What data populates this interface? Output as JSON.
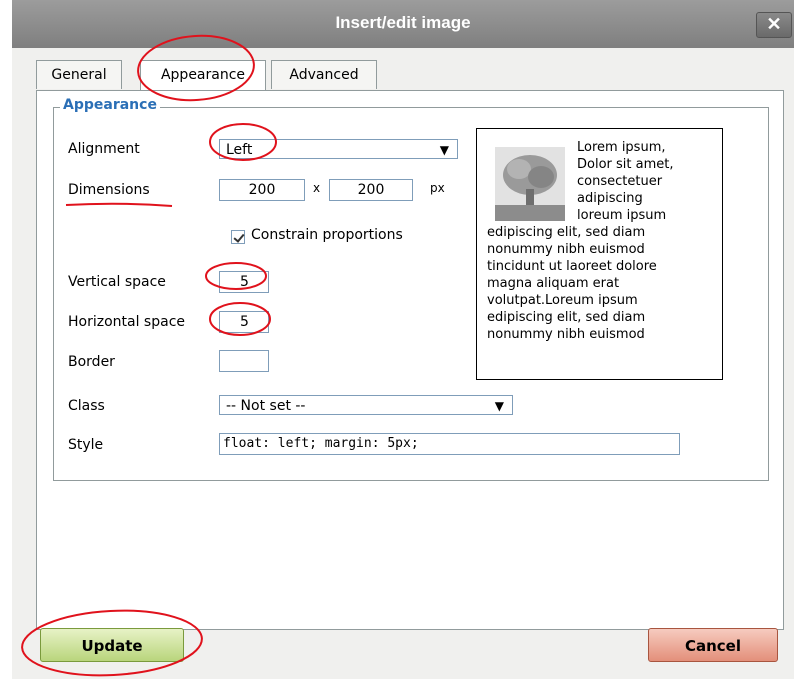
{
  "dialog": {
    "title": "Insert/edit image",
    "close_symbol": "✕"
  },
  "tabs": [
    {
      "label": "General"
    },
    {
      "label": "Appearance"
    },
    {
      "label": "Advanced"
    }
  ],
  "appearance": {
    "legend": "Appearance",
    "alignment": {
      "label": "Alignment",
      "value": "Left"
    },
    "dimensions": {
      "label": "Dimensions",
      "width": "200",
      "separator": "x",
      "height": "200",
      "unit": "px"
    },
    "constrain": {
      "label": "Constrain proportions",
      "checked": true
    },
    "vertical_space": {
      "label": "Vertical space",
      "value": "5"
    },
    "horizontal_space": {
      "label": "Horizontal space",
      "value": "5"
    },
    "border": {
      "label": "Border",
      "value": ""
    },
    "class": {
      "label": "Class",
      "value": "-- Not set --"
    },
    "style": {
      "label": "Style",
      "value": "float: left; margin: 5px;"
    }
  },
  "preview": {
    "lines_beside": [
      "Lorem ipsum,",
      "Dolor sit amet,",
      "consectetuer",
      "adipiscing",
      "loreum ipsum"
    ],
    "lines_below": [
      "edipiscing elit, sed diam",
      "nonummy nibh euismod",
      "tincidunt ut laoreet dolore",
      "magna aliquam erat",
      "volutpat.Loreum ipsum",
      "edipiscing elit, sed diam",
      "nonummy nibh euismod"
    ]
  },
  "buttons": {
    "update": "Update",
    "cancel": "Cancel"
  },
  "colors": {
    "legend": "#2b6fb6",
    "annotation": "#e0121c",
    "update_button": "#b9d57c",
    "cancel_button": "#e38f7a"
  }
}
